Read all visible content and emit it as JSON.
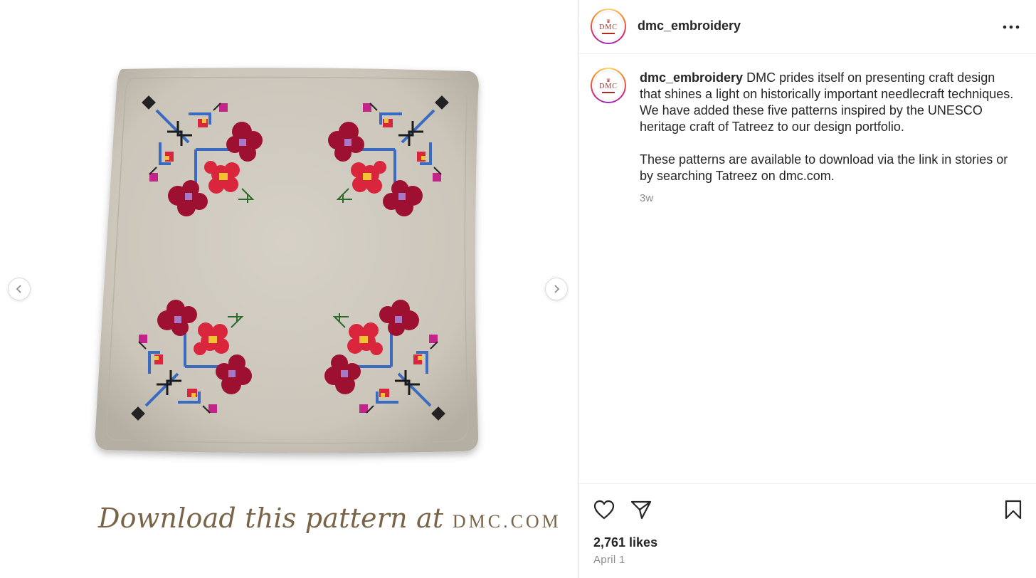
{
  "post": {
    "username": "dmc_embroidery",
    "avatar_logo_text": "DMC",
    "caption_para1": "DMC prides itself on presenting craft design that shines a light on historically important needlecraft techniques. We have added these five patterns inspired by the UNESCO heritage craft of Tatreez to our design portfolio.",
    "caption_para2": "These patterns are available to download via the link in stories or by searching Tatreez on dmc.com.",
    "time_ago": "3w",
    "likes": "2,761 likes",
    "date": "April 1"
  },
  "media": {
    "caption_script": "Download this pattern at",
    "caption_brand": "DMC.COM"
  },
  "icons": {
    "more": "more-options-icon",
    "like": "heart-icon",
    "share": "paper-plane-icon",
    "save": "bookmark-icon",
    "prev": "chevron-left-icon",
    "next": "chevron-right-icon"
  },
  "colors": {
    "fabric": "#cfcac0",
    "caption": "#7a6448",
    "embroidery_red": "#9e1030",
    "embroidery_blue": "#3a6bc0",
    "secondary_text": "#8e8e8e"
  }
}
